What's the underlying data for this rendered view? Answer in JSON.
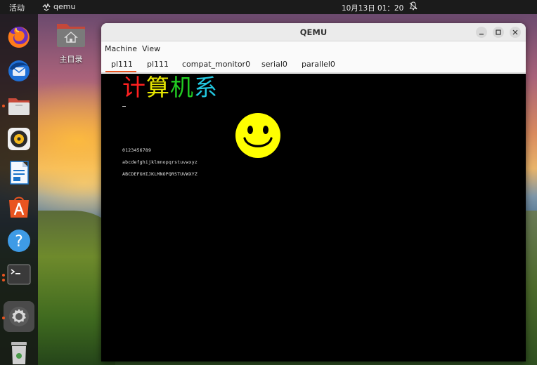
{
  "topbar": {
    "activities": "活动",
    "app_name": "qemu",
    "clock": "10月13日  01：20"
  },
  "desktop": {
    "home_label": "主目录"
  },
  "dock": {
    "items": [
      "firefox-icon",
      "thunderbird-icon",
      "files-icon",
      "rhythmbox-icon",
      "libreoffice-writer-icon",
      "app-center-icon",
      "help-icon",
      "terminal-icon",
      "settings-icon",
      "trash-icon"
    ]
  },
  "window": {
    "title": "QEMU",
    "menu": [
      "Machine",
      "View"
    ],
    "tabs": [
      "pl111",
      "pl111",
      "compat_monitor0",
      "serial0",
      "parallel0"
    ],
    "active_tab": 0
  },
  "screen": {
    "hanzi": [
      {
        "char": "计",
        "color": "#ff2020"
      },
      {
        "char": "算",
        "color": "#e6e600"
      },
      {
        "char": "机",
        "color": "#22cc22"
      },
      {
        "char": "系",
        "color": "#22c8e0"
      }
    ],
    "digits": "0123456789",
    "lowercase": "abcdefghijklmnopqrstuvwxyz",
    "uppercase": "ABCDEFGHIJKLMNOPQRSTUVWXYZ",
    "smiley_color": "#ffff00"
  },
  "colors": {
    "accent": "#e95420"
  }
}
